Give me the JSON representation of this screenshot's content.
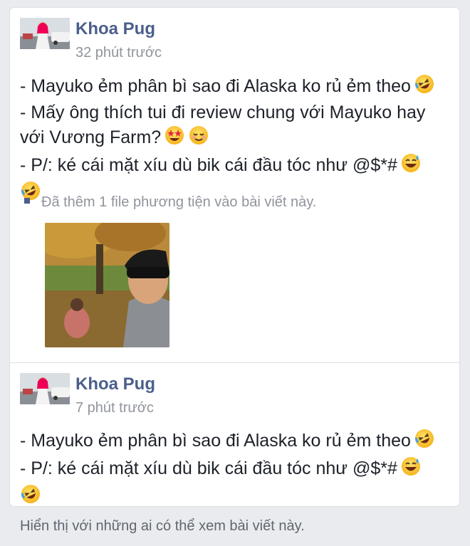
{
  "posts": [
    {
      "author": "Khoa Pug",
      "time": "32 phút trước",
      "lines": [
        "- Mayuko ẻm phân bì sao đi Alaska ko rủ ẻm theo",
        "- Mấy ông thích tui đi review chung với Mayuko hay",
        "với Vương Farm?",
        "- P/: ké cái mặt xíu dù bik cái đầu tóc như @$*#"
      ],
      "media_note": "Đã thêm 1 file phương tiện vào bài viết này."
    },
    {
      "author": "Khoa Pug",
      "time": "7 phút trước",
      "lines": [
        "- Mayuko ẻm phân bì sao đi Alaska ko rủ ẻm theo",
        "- P/: ké cái mặt xíu dù bik cái đầu tóc như @$*#"
      ]
    }
  ],
  "footer": "Hiển thị với những ai có thể xem bài viết này.",
  "colors": {
    "author": "#4b5f8c",
    "meta": "#90949c",
    "background": "#e9ebee"
  },
  "icons": [
    "rofl-emoji",
    "star-struck-emoji",
    "relieved-emoji",
    "sweat-smile-emoji"
  ]
}
